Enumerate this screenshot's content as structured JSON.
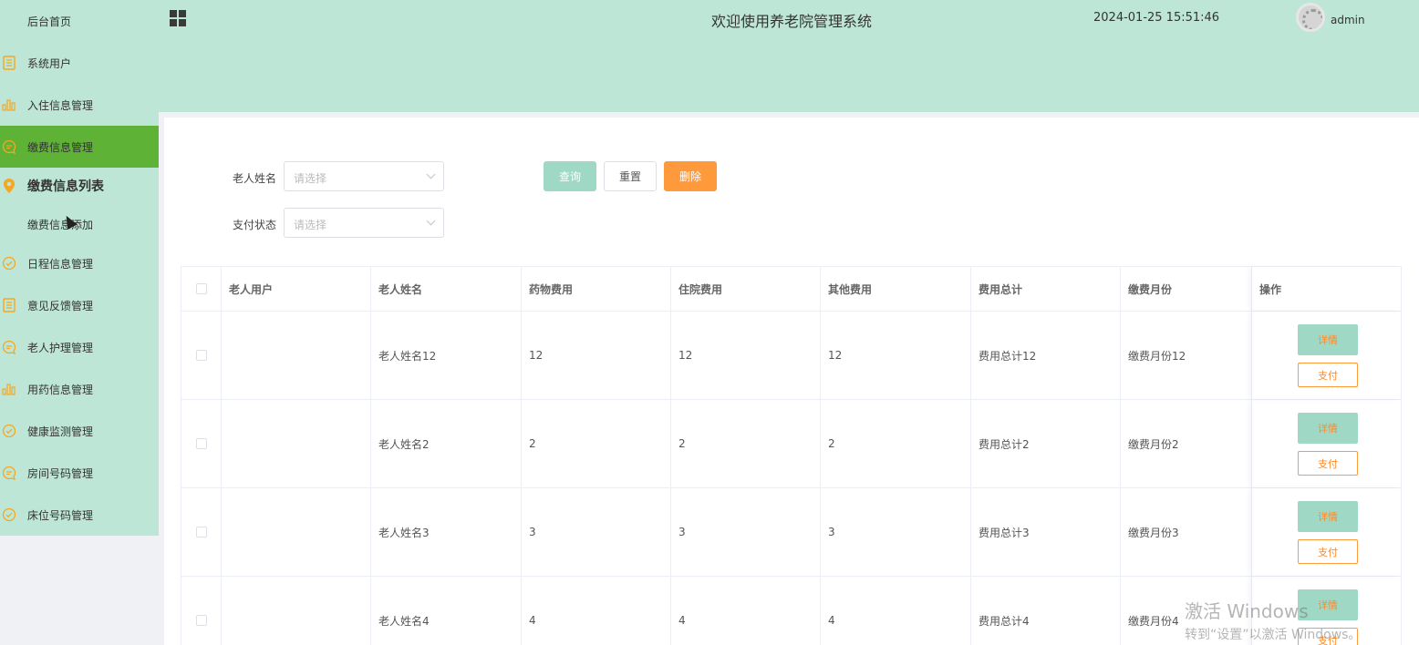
{
  "colors": {
    "sidebar_bg": "#bde6d6",
    "active_item": "#5eb236",
    "icon_orange": "#f5a623",
    "primary": "#9fd8c4",
    "danger": "#ff9a3c"
  },
  "sidebar": {
    "items": [
      {
        "label": "后台首页",
        "icon": "none"
      },
      {
        "label": "系统用户",
        "icon": "document-icon"
      },
      {
        "label": "入住信息管理",
        "icon": "bar-chart-icon"
      },
      {
        "label": "缴费信息管理",
        "icon": "chat-icon",
        "active": true
      },
      {
        "label": "缴费信息列表",
        "icon": "location-pin-icon",
        "sub_active": true
      },
      {
        "label": "缴费信息添加",
        "icon": "none"
      },
      {
        "label": "日程信息管理",
        "icon": "check-circle-icon"
      },
      {
        "label": "意见反馈管理",
        "icon": "document-icon"
      },
      {
        "label": "老人护理管理",
        "icon": "chat-icon"
      },
      {
        "label": "用药信息管理",
        "icon": "bar-chart-icon"
      },
      {
        "label": "健康监测管理",
        "icon": "check-circle-icon"
      },
      {
        "label": "房间号码管理",
        "icon": "chat-icon"
      },
      {
        "label": "床位号码管理",
        "icon": "check-circle-icon"
      }
    ]
  },
  "header": {
    "title": "欢迎使用养老院管理系统",
    "datetime": "2024-01-25 15:51:46",
    "username": "admin"
  },
  "search": {
    "name_label": "老人姓名",
    "name_placeholder": "请选择",
    "status_label": "支付状态",
    "status_placeholder": "请选择",
    "query_label": "查询",
    "reset_label": "重置",
    "delete_label": "删除"
  },
  "table": {
    "headers": [
      "老人用户",
      "老人姓名",
      "药物费用",
      "住院费用",
      "其他费用",
      "费用总计",
      "缴费月份",
      "操作"
    ],
    "detail_label": "详情",
    "pay_label": "支付",
    "rows": [
      {
        "user": "",
        "name": "老人姓名12",
        "drug": "12",
        "hospital": "12",
        "other": "12",
        "total": "费用总计12",
        "month": "缴费月份12"
      },
      {
        "user": "",
        "name": "老人姓名2",
        "drug": "2",
        "hospital": "2",
        "other": "2",
        "total": "费用总计2",
        "month": "缴费月份2"
      },
      {
        "user": "",
        "name": "老人姓名3",
        "drug": "3",
        "hospital": "3",
        "other": "3",
        "total": "费用总计3",
        "month": "缴费月份3"
      },
      {
        "user": "",
        "name": "老人姓名4",
        "drug": "4",
        "hospital": "4",
        "other": "4",
        "total": "费用总计4",
        "month": "缴费月份4"
      }
    ]
  },
  "watermark": {
    "line1": "激活 Windows",
    "line2": "转到“设置”以激活 Windows。"
  }
}
